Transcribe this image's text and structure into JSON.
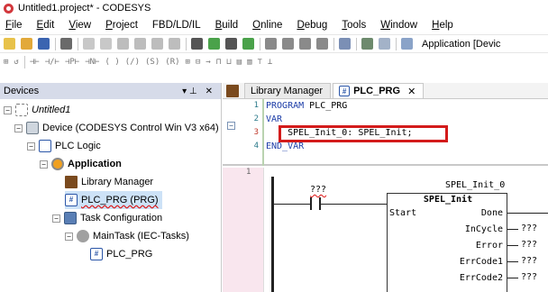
{
  "window": {
    "title": "Untitled1.project* - CODESYS"
  },
  "menu": [
    {
      "label": "File",
      "key": "F",
      "rest": "ile"
    },
    {
      "label": "Edit",
      "key": "E",
      "rest": "dit"
    },
    {
      "label": "View",
      "key": "V",
      "rest": "iew"
    },
    {
      "label": "Project",
      "key": "P",
      "rest": "roject"
    },
    {
      "label": "FBD/LD/IL",
      "key": "",
      "rest": "FBD/LD/IL"
    },
    {
      "label": "Build",
      "key": "B",
      "rest": "uild"
    },
    {
      "label": "Online",
      "key": "O",
      "rest": "nline"
    },
    {
      "label": "Debug",
      "key": "D",
      "rest": "ebug"
    },
    {
      "label": "Tools",
      "key": "T",
      "rest": "ools"
    },
    {
      "label": "Window",
      "key": "W",
      "rest": "indow"
    },
    {
      "label": "Help",
      "key": "H",
      "rest": "elp"
    }
  ],
  "toolbar": {
    "application_label": "Application [Devic"
  },
  "devices_panel": {
    "title": "Devices",
    "pin_glyph": "▾ ⊥",
    "close_glyph": "✕",
    "project": "Untitled1",
    "tree": [
      {
        "label": "Device (CODESYS Control Win V3 x64)",
        "icon": "device-icon"
      },
      {
        "label": "PLC Logic",
        "icon": "plc-logic-icon"
      },
      {
        "label": "Application",
        "icon": "application-icon"
      },
      {
        "label": "Library Manager",
        "icon": "library-manager-icon"
      },
      {
        "label": "PLC_PRG (PRG)",
        "icon": "program-icon"
      },
      {
        "label": "Task Configuration",
        "icon": "task-configuration-icon"
      },
      {
        "label": "MainTask (IEC-Tasks)",
        "icon": "task-icon"
      },
      {
        "label": "PLC_PRG",
        "icon": "program-icon"
      }
    ]
  },
  "editor": {
    "tabs": [
      {
        "label": "Library Manager",
        "active": false
      },
      {
        "label": "PLC_PRG",
        "active": true,
        "close": "✕"
      }
    ],
    "declaration": {
      "line_numbers": [
        "1",
        "2",
        "3",
        "4"
      ],
      "lines": [
        {
          "kw": "PROGRAM",
          "text": " PLC_PRG"
        },
        {
          "kw": "VAR",
          "text": ""
        },
        {
          "kw": "",
          "text": "    SPEL_Init_0: SPEL_Init;"
        },
        {
          "kw": "END_VAR",
          "text": ""
        }
      ]
    },
    "ladder": {
      "rung_number": "1",
      "contact_label": "???",
      "fb_instance": "SPEL_Init_0",
      "fb_type": "SPEL_Init",
      "inputs": [
        "Start"
      ],
      "outputs": [
        {
          "name": "Done",
          "value": ""
        },
        {
          "name": "InCycle",
          "value": "???"
        },
        {
          "name": "Error",
          "value": "???"
        },
        {
          "name": "ErrCode1",
          "value": "???"
        },
        {
          "name": "ErrCode2",
          "value": "???"
        }
      ]
    }
  }
}
